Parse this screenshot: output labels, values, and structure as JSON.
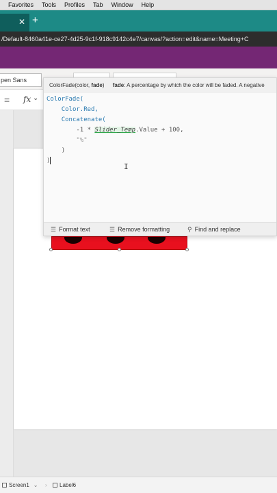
{
  "menubar": {
    "items": [
      "Favorites",
      "Tools",
      "Profiles",
      "Tab",
      "Window",
      "Help"
    ]
  },
  "browser": {
    "close_glyph": "✕",
    "new_tab_glyph": "+",
    "address": "/Default-8460a41e-ce27-4d25-9c1f-918c9142c4e7/canvas/?action=edit&name=Meeting+C"
  },
  "ribbon": {
    "font_name": "pen Sans"
  },
  "formula_bar": {
    "equals": "=",
    "fx": "fx",
    "chevron": "⌄"
  },
  "editor": {
    "hint_signature_prefix": "ColorFade(color, ",
    "hint_signature_param": "fade",
    "hint_signature_suffix": ")",
    "hint_param_name": "fade",
    "hint_description": ": A percentage by which the color will be faded. A negative",
    "code": {
      "l1_fn": "ColorFade(",
      "l2": "Color.Red,",
      "l3_fn": "Concatenate(",
      "l4_pre": "-1 * ",
      "l4_var": "Slider_Temp",
      "l4_post": ".Value + 100,",
      "l5": "\"%\"",
      "l6": ")",
      "l7": ")"
    },
    "toolbar": {
      "format_text": "Format text",
      "remove_formatting": "Remove formatting",
      "find_replace": "Find and replace"
    }
  },
  "statusbar": {
    "screen": "Screen1",
    "label": "Label6"
  },
  "colors": {
    "appbar": "#742774",
    "tabstrip": "#1d8a86",
    "label_fill": "#e8101e"
  }
}
